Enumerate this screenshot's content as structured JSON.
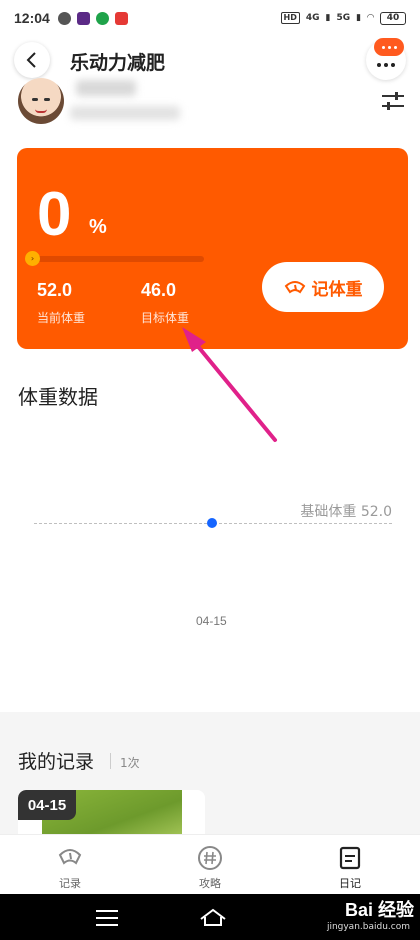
{
  "status_bar": {
    "time": "12:04",
    "network_1": "HD",
    "network_2": "4G",
    "network_3": "5G",
    "battery": "40"
  },
  "header": {
    "title": "乐动力减肥"
  },
  "progress_card": {
    "percent": "0",
    "percent_unit": "%",
    "progress_fraction": 0,
    "current_weight": "52.0",
    "current_weight_label": "当前体重",
    "target_weight": "46.0",
    "target_weight_label": "目标体重",
    "record_button_label": "记体重",
    "card_color": "#ff5a00"
  },
  "weight_data": {
    "section_title": "体重数据",
    "baseline_label": "基础体重 52.0",
    "x_tick": "04-15",
    "point_color": "#1565ff"
  },
  "records": {
    "section_title": "我的记录",
    "count": "1次",
    "items": [
      {
        "date": "04-15"
      }
    ]
  },
  "tabbar": {
    "tabs": [
      {
        "label": "记录",
        "icon": "scale-icon"
      },
      {
        "label": "攻略",
        "icon": "hashtag-icon"
      },
      {
        "label": "日记",
        "icon": "diary-icon"
      }
    ],
    "active_index": 2
  },
  "watermark": {
    "brand": "Bai 经验",
    "url": "jingyan.baidu.com"
  }
}
